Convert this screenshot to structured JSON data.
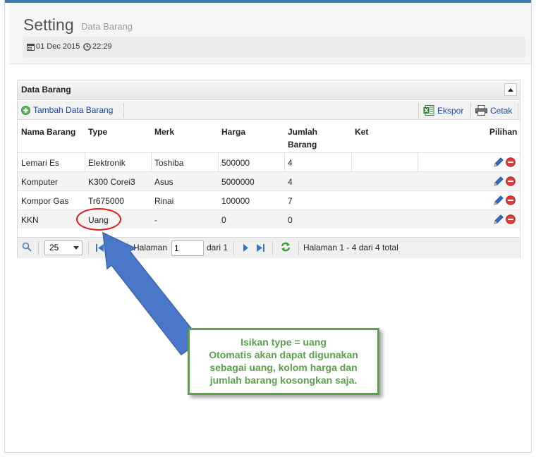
{
  "header": {
    "title": "Setting",
    "subtitle": "Data Barang",
    "date": "01 Dec 2015",
    "time": "22:29"
  },
  "panel": {
    "title": "Data Barang",
    "toolbar": {
      "add_label": "Tambah Data Barang",
      "export_label": "Ekspor",
      "print_label": "Cetak"
    },
    "columns": {
      "nama": "Nama Barang",
      "type": "Type",
      "merk": "Merk",
      "harga": "Harga",
      "jumlah_1": "Jumlah",
      "jumlah_2": "Barang",
      "ket": "Ket",
      "pilihan": "Pilihan"
    },
    "rows": [
      {
        "nama": "Lemari Es",
        "type": "Elektronik",
        "merk": "Toshiba",
        "harga": "500000",
        "jumlah": "4",
        "ket": ""
      },
      {
        "nama": "Komputer",
        "type": "K300 Corei3",
        "merk": "Asus",
        "harga": "5000000",
        "jumlah": "4",
        "ket": ""
      },
      {
        "nama": "Kompor Gas",
        "type": "Tr675000",
        "merk": "Rinai",
        "harga": "100000",
        "jumlah": "7",
        "ket": ""
      },
      {
        "nama": "KKN",
        "type": "Uang",
        "merk": "-",
        "harga": "0",
        "jumlah": "0",
        "ket": ""
      }
    ],
    "pager": {
      "page_size": "25",
      "page_label": "Halaman",
      "page_value": "1",
      "of_label": "dari 1",
      "summary": "Halaman 1 - 4 dari 4 total"
    }
  },
  "annotation": {
    "lines": [
      "Isikan type = uang",
      "Otomatis akan dapat digunakan",
      "sebagai uang, kolom harga dan",
      "jumlah barang kosongkan saja."
    ]
  },
  "colors": {
    "accent_blue": "#3f7bb3",
    "callout_green": "#5aa04a",
    "circle_red": "#e11b1b",
    "arrow_blue": "#4a78c8"
  }
}
